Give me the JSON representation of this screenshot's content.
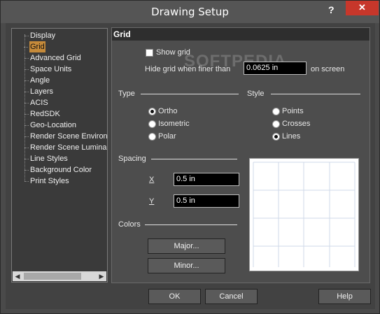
{
  "window": {
    "title": "Drawing Setup",
    "help_glyph": "?",
    "close_glyph": "✕"
  },
  "tree": {
    "items": [
      {
        "label": "Display"
      },
      {
        "label": "Grid"
      },
      {
        "label": "Advanced Grid"
      },
      {
        "label": "Space Units"
      },
      {
        "label": "Angle"
      },
      {
        "label": "Layers"
      },
      {
        "label": "ACIS"
      },
      {
        "label": "RedSDK"
      },
      {
        "label": "Geo-Location"
      },
      {
        "label": "Render Scene Environm"
      },
      {
        "label": "Render Scene Luminar"
      },
      {
        "label": "Line Styles"
      },
      {
        "label": "Background Color"
      },
      {
        "label": "Print Styles"
      }
    ],
    "selected": "Grid"
  },
  "panel": {
    "title": "Grid",
    "show_grid_label": "Show grid",
    "show_grid_checked": false,
    "hide_grid_label": "Hide grid when finer than",
    "hide_grid_value": "0.0625 in",
    "hide_grid_suffix": "on screen",
    "type_label": "Type",
    "type_options": [
      "Ortho",
      "Isometric",
      "Polar"
    ],
    "type_selected": "Ortho",
    "style_label": "Style",
    "style_options": [
      "Points",
      "Crosses",
      "Lines"
    ],
    "style_selected": "Lines",
    "spacing_label": "Spacing",
    "x_label": "X",
    "x_value": "0.5 in",
    "y_label": "Y",
    "y_value": "0.5 in",
    "colors_label": "Colors",
    "major_button": "Major...",
    "minor_button": "Minor...",
    "watermark": "SOFTPEDIA"
  },
  "footer": {
    "ok": "OK",
    "cancel": "Cancel",
    "help": "Help"
  }
}
